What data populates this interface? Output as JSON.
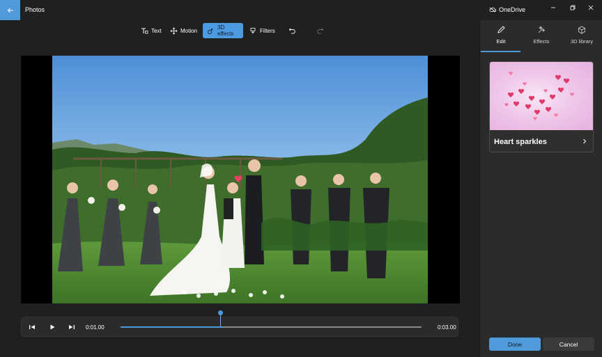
{
  "window": {
    "app_title": "Photos",
    "cloud_label": "OneDrive"
  },
  "toolbar": {
    "text_label": "Text",
    "motion_label": "Motion",
    "effects3d_label": "3D effects",
    "filters_label": "Filters"
  },
  "playback": {
    "current_time": "0:01.00",
    "total_time": "0:03.00",
    "progress": 0.34
  },
  "panel": {
    "tabs": [
      {
        "label": "Edit",
        "icon": "pencil-icon",
        "active": true
      },
      {
        "label": "Effects",
        "icon": "sparkle-icon",
        "active": false
      },
      {
        "label": "3D library",
        "icon": "cube-icon",
        "active": false
      }
    ],
    "effect_name": "Heart sparkles",
    "done_label": "Done",
    "cancel_label": "Cancel"
  },
  "colors": {
    "accent": "#4f9bd9",
    "background": "#202020",
    "panel": "#2b2b2b"
  }
}
